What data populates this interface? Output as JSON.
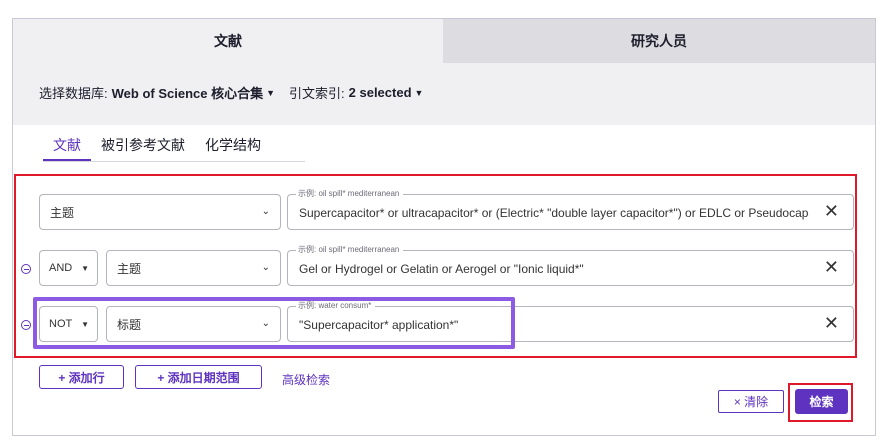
{
  "top_tabs": [
    {
      "label": "文献",
      "active": true
    },
    {
      "label": "研究人员",
      "active": false
    }
  ],
  "database": {
    "label": "选择数据库:",
    "value": "Web of Science 核心合集",
    "citation_label": "引文索引:",
    "citation_value": "2 selected"
  },
  "sub_tabs": [
    {
      "label": "文献",
      "active": true
    },
    {
      "label": "被引参考文献",
      "active": false
    },
    {
      "label": "化学结构",
      "active": false
    }
  ],
  "rows": [
    {
      "operator": "",
      "field": "主题",
      "hint": "示例: oil spill* mediterranean",
      "value": "Supercapacitor* or ultracapacitor* or (Electric* \"double layer capacitor*\") or EDLC or Pseudocapacitor*"
    },
    {
      "operator": "AND",
      "field": "主题",
      "hint": "示例: oil spill* mediterranean",
      "value": "Gel or Hydrogel or Gelatin or Aerogel or \"Ionic liquid*\""
    },
    {
      "operator": "NOT",
      "field": "标题",
      "hint": "示例: water consum*",
      "value": "\"Supercapacitor* application*\""
    }
  ],
  "actions": {
    "add_row": "+ 添加行",
    "add_date_range": "+ 添加日期范围",
    "advanced_search": "高级检索",
    "clear": "× 清除",
    "search": "检索"
  },
  "icons": {
    "chevron": "chevron-down-icon",
    "clear": "close-icon",
    "remove_row": "minus-circle-icon"
  },
  "colors": {
    "accent": "#5e33bf",
    "highlight_red": "#e0192a",
    "highlight_purple": "#8d5be3"
  }
}
